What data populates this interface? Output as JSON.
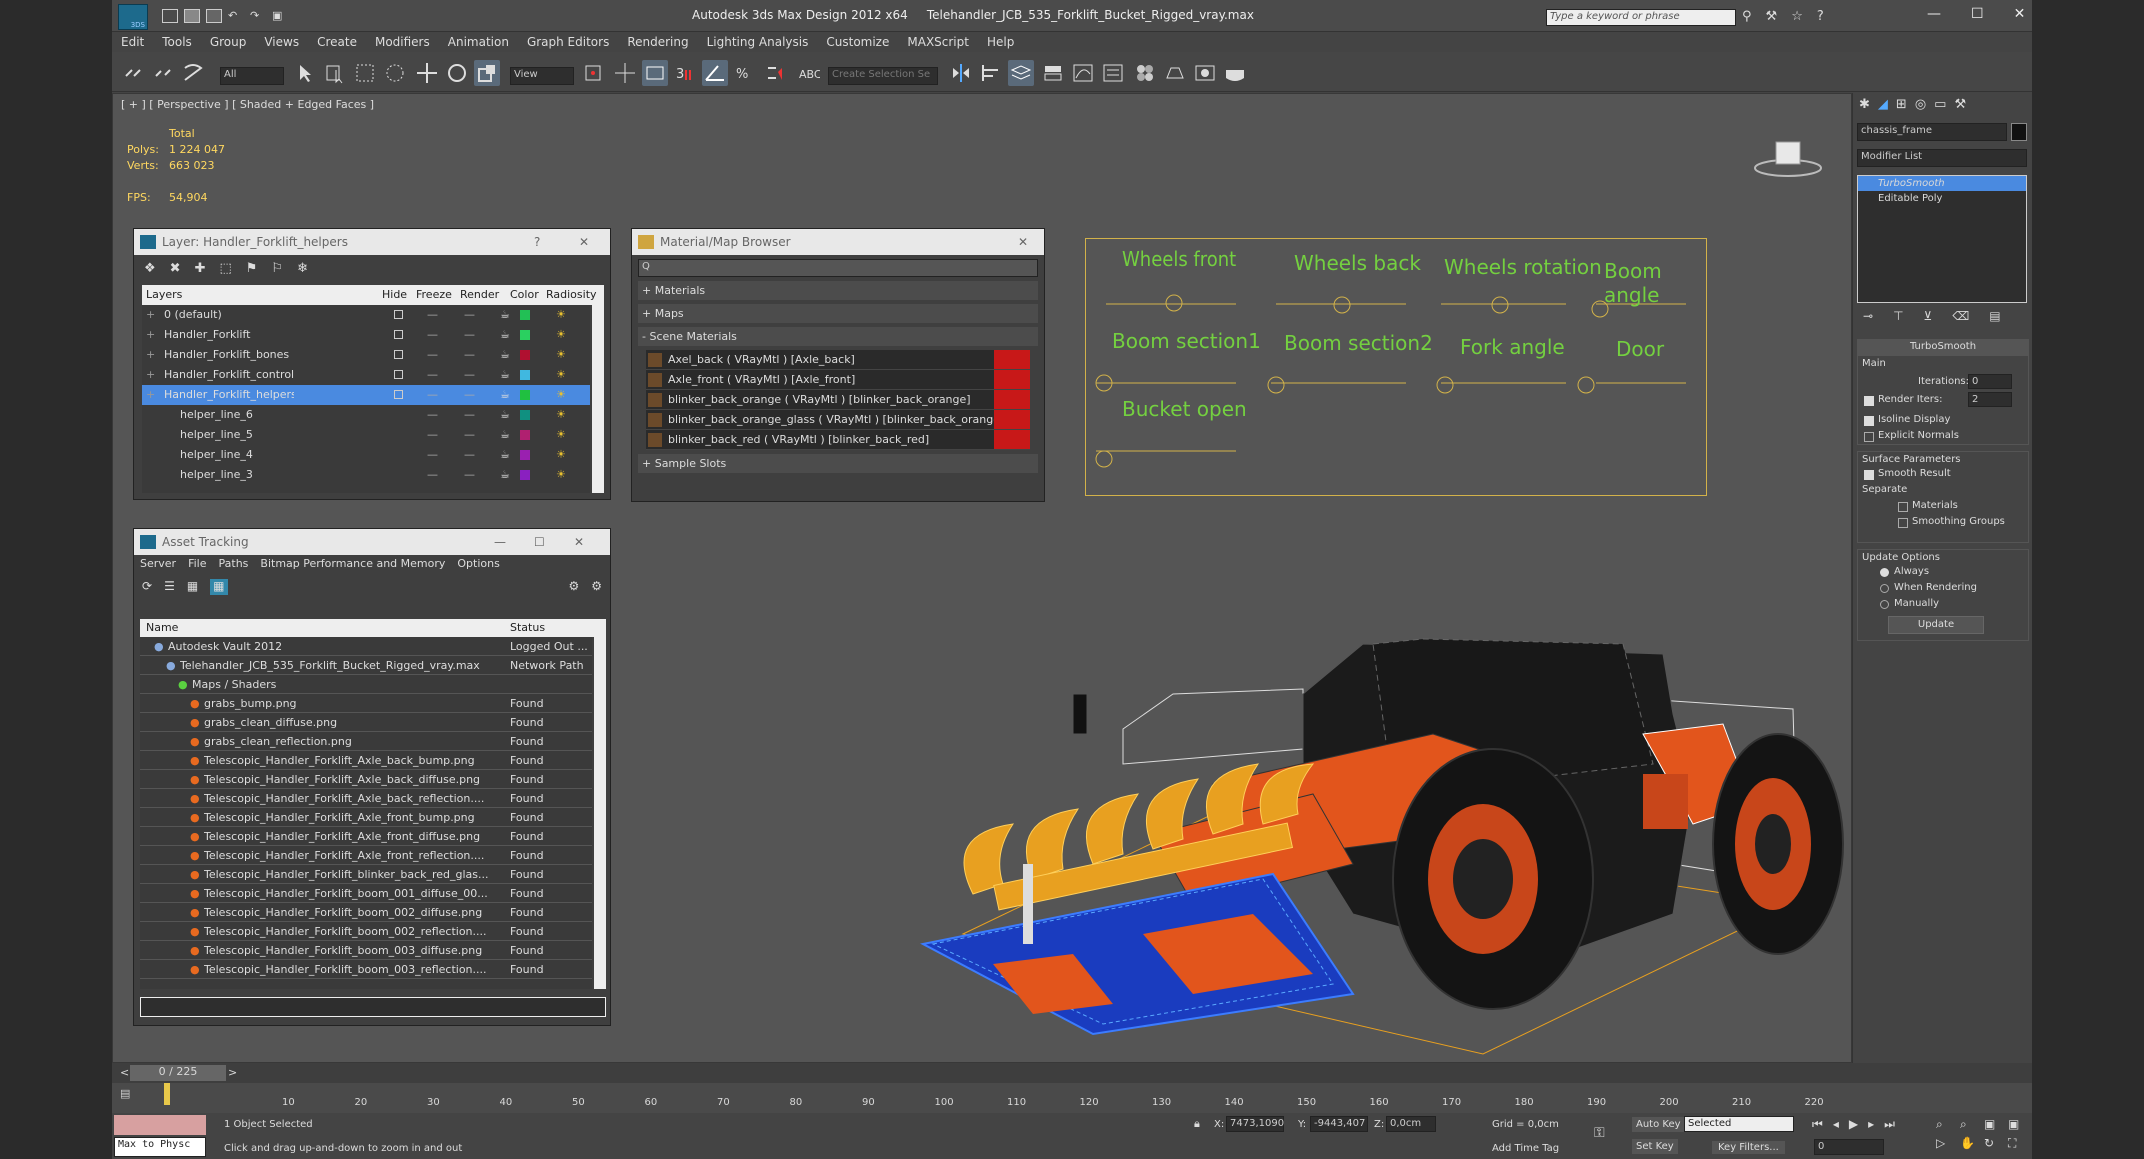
{
  "window": {
    "title": "Autodesk 3ds Max Design 2012 x64",
    "filename": "Telehandler_JCB_535_Forklift_Bucket_Rigged_vray.max",
    "search_placeholder": "Type a keyword or phrase",
    "min": "—",
    "max": "☐",
    "close": "✕",
    "logo": "3DS"
  },
  "menu": [
    "Edit",
    "Tools",
    "Group",
    "Views",
    "Create",
    "Modifiers",
    "Animation",
    "Graph Editors",
    "Rendering",
    "Lighting Analysis",
    "Customize",
    "MAXScript",
    "Help"
  ],
  "toolbar": {
    "filter": "All",
    "refcoord": "View",
    "selset": "Create Selection Se"
  },
  "viewport": {
    "label": "[ + ] [ Perspective ] [ Shaded + Edged Faces ]",
    "total_label": "Total",
    "polys_label": "Polys:",
    "polys": "1 224 047",
    "verts_label": "Verts:",
    "verts": "663 023",
    "fps_label": "FPS:",
    "fps": "54,904"
  },
  "rig_labels": [
    "Wheels front",
    "Wheels back",
    "Wheels rotation",
    "Boom angle",
    "Boom section1",
    "Boom section2",
    "Fork angle",
    "Door",
    "Bucket open"
  ],
  "layer_panel": {
    "title": "Layer: Handler_Forklift_helpers",
    "help": "?",
    "close": "✕",
    "columns": [
      "Layers",
      "Hide",
      "Freeze",
      "Render",
      "Color",
      "Radiosity"
    ],
    "rows": [
      {
        "name": "0 (default)",
        "color": "#22c055",
        "selected": false,
        "indent": 0
      },
      {
        "name": "Handler_Forklift",
        "color": "#2ad060",
        "selected": false,
        "indent": 0
      },
      {
        "name": "Handler_Forklift_bones",
        "color": "#b01030",
        "selected": false,
        "indent": 0
      },
      {
        "name": "Handler_Forklift_controllers",
        "color": "#40b8e0",
        "selected": false,
        "indent": 0
      },
      {
        "name": "Handler_Forklift_helpers",
        "color": "#20c040",
        "selected": true,
        "indent": 0
      },
      {
        "name": "helper_line_6",
        "color": "#109080",
        "selected": false,
        "indent": 1
      },
      {
        "name": "helper_line_5",
        "color": "#b02070",
        "selected": false,
        "indent": 1
      },
      {
        "name": "helper_line_4",
        "color": "#9a20b0",
        "selected": false,
        "indent": 1
      },
      {
        "name": "helper_line_3",
        "color": "#8a20c0",
        "selected": false,
        "indent": 1
      }
    ]
  },
  "material_panel": {
    "title": "Material/Map Browser",
    "close": "✕",
    "search": "Q",
    "sections": [
      "+ Materials",
      "+ Maps",
      "- Scene Materials",
      "+ Sample Slots"
    ],
    "materials": [
      "Axel_back ( VRayMtl ) [Axle_back]",
      "Axle_front ( VRayMtl ) [Axle_front]",
      "blinker_back_orange ( VRayMtl ) [blinker_back_orange]",
      "blinker_back_orange_glass ( VRayMtl ) [blinker_back_orange_glass]",
      "blinker_back_red ( VRayMtl ) [blinker_back_red]"
    ]
  },
  "asset_panel": {
    "title": "Asset Tracking",
    "close": "✕",
    "menu": [
      "Server",
      "File",
      "Paths",
      "Bitmap Performance and Memory",
      "Options"
    ],
    "col_name": "Name",
    "col_status": "Status",
    "rows": [
      {
        "name": "Autodesk Vault 2012",
        "status": "Logged Out ...",
        "indent": 0
      },
      {
        "name": "Telehandler_JCB_535_Forklift_Bucket_Rigged_vray.max",
        "status": "Network Path",
        "indent": 1
      },
      {
        "name": "Maps / Shaders",
        "status": "",
        "indent": 2
      },
      {
        "name": "grabs_bump.png",
        "status": "Found",
        "indent": 3
      },
      {
        "name": "grabs_clean_diffuse.png",
        "status": "Found",
        "indent": 3
      },
      {
        "name": "grabs_clean_reflection.png",
        "status": "Found",
        "indent": 3
      },
      {
        "name": "Telescopic_Handler_Forklift_Axle_back_bump.png",
        "status": "Found",
        "indent": 3
      },
      {
        "name": "Telescopic_Handler_Forklift_Axle_back_diffuse.png",
        "status": "Found",
        "indent": 3
      },
      {
        "name": "Telescopic_Handler_Forklift_Axle_back_reflection....",
        "status": "Found",
        "indent": 3
      },
      {
        "name": "Telescopic_Handler_Forklift_Axle_front_bump.png",
        "status": "Found",
        "indent": 3
      },
      {
        "name": "Telescopic_Handler_Forklift_Axle_front_diffuse.png",
        "status": "Found",
        "indent": 3
      },
      {
        "name": "Telescopic_Handler_Forklift_Axle_front_reflection....",
        "status": "Found",
        "indent": 3
      },
      {
        "name": "Telescopic_Handler_Forklift_blinker_back_red_glas...",
        "status": "Found",
        "indent": 3
      },
      {
        "name": "Telescopic_Handler_Forklift_boom_001_diffuse_00...",
        "status": "Found",
        "indent": 3
      },
      {
        "name": "Telescopic_Handler_Forklift_boom_002_diffuse.png",
        "status": "Found",
        "indent": 3
      },
      {
        "name": "Telescopic_Handler_Forklift_boom_002_reflection....",
        "status": "Found",
        "indent": 3
      },
      {
        "name": "Telescopic_Handler_Forklift_boom_003_diffuse.png",
        "status": "Found",
        "indent": 3
      },
      {
        "name": "Telescopic_Handler_Forklift_boom_003_reflection....",
        "status": "Found",
        "indent": 3
      }
    ]
  },
  "command_panel": {
    "object_name": "chassis_frame",
    "modifier_list": "Modifier List",
    "stack": [
      "TurboSmooth",
      "Editable Poly"
    ],
    "rollout": "TurboSmooth",
    "main": "Main",
    "iterations_label": "Iterations:",
    "iterations": "0",
    "render_iters_label": "Render Iters:",
    "render_iters": "2",
    "isoline": "Isoline Display",
    "explicit": "Explicit Normals",
    "surface": "Surface Parameters",
    "smooth": "Smooth Result",
    "separate": "Separate",
    "materials": "Materials",
    "smoothing": "Smoothing Groups",
    "update_options": "Update Options",
    "always": "Always",
    "when_rendering": "When Rendering",
    "manually": "Manually",
    "update": "Update"
  },
  "timeline": {
    "frame": "0 / 225",
    "ticks": [
      "10",
      "20",
      "30",
      "40",
      "50",
      "60",
      "70",
      "80",
      "90",
      "100",
      "110",
      "120",
      "130",
      "140",
      "150",
      "160",
      "170",
      "180",
      "190",
      "200",
      "210",
      "220"
    ]
  },
  "status": {
    "selected": "1 Object Selected",
    "prompt": "Click and drag up-and-down to zoom in and out",
    "script": "Max to Physc",
    "x_label": "X:",
    "x": "7473,1090",
    "y_label": "Y:",
    "y": "-9443,407",
    "z_label": "Z:",
    "z": "0,0cm",
    "grid": "Grid = 0,0cm",
    "auto_key": "Auto Key",
    "set_key": "Set Key",
    "selected_dd": "Selected",
    "key_filters": "Key Filters...",
    "add_time_tag": "Add Time Tag",
    "frame": "0"
  }
}
